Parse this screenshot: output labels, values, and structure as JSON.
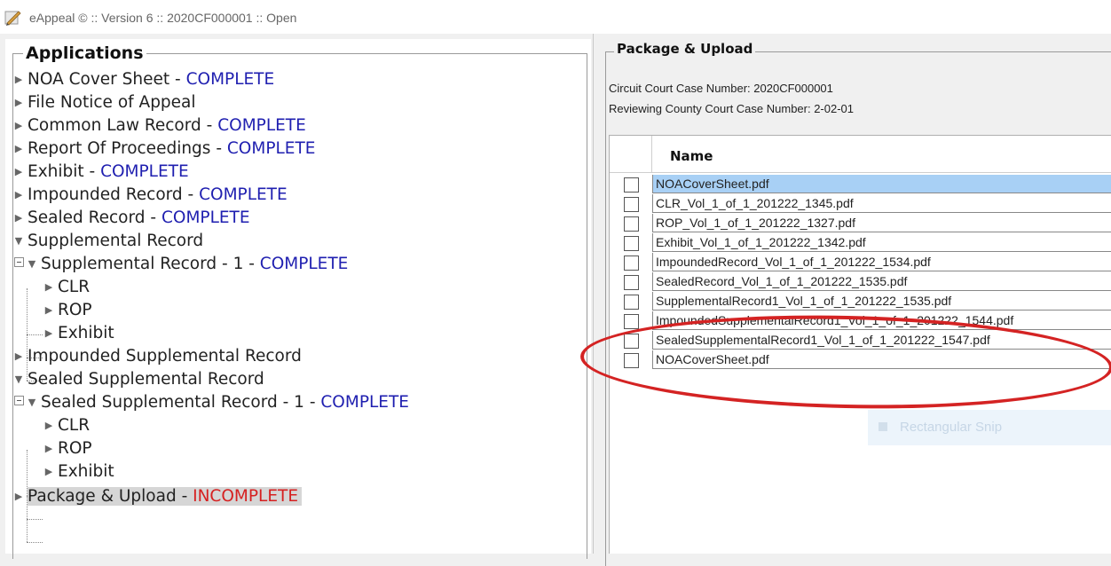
{
  "window": {
    "title": "eAppeal © :: Version 6 :: 2020CF000001 :: Open"
  },
  "colors": {
    "complete": "#1f1fb0",
    "incomplete": "#d62020",
    "selected_row": "#a8d0f5",
    "annotation": "#d42323"
  },
  "applications": {
    "title": "Applications",
    "items": [
      {
        "label": "NOA Cover Sheet - ",
        "status": "COMPLETE"
      },
      {
        "label": "File Notice of Appeal",
        "status": ""
      },
      {
        "label": "Common Law Record - ",
        "status": "COMPLETE"
      },
      {
        "label": "Report Of Proceedings - ",
        "status": "COMPLETE"
      },
      {
        "label": "Exhibit - ",
        "status": "COMPLETE"
      },
      {
        "label": "Impounded Record - ",
        "status": "COMPLETE"
      },
      {
        "label": "Sealed Record - ",
        "status": "COMPLETE"
      },
      {
        "label": "Supplemental Record",
        "status": ""
      },
      {
        "label": "Supplemental Record - 1 - ",
        "status": "COMPLETE"
      },
      {
        "label": "CLR",
        "status": ""
      },
      {
        "label": "ROP",
        "status": ""
      },
      {
        "label": "Exhibit",
        "status": ""
      },
      {
        "label": "Impounded Supplemental Record",
        "status": ""
      },
      {
        "label": "Sealed Supplemental Record",
        "status": ""
      },
      {
        "label": "Sealed Supplemental Record - 1 - ",
        "status": "COMPLETE"
      },
      {
        "label": "CLR",
        "status": ""
      },
      {
        "label": "ROP",
        "status": ""
      },
      {
        "label": "Exhibit",
        "status": ""
      },
      {
        "label": "Package & Upload - ",
        "status": "INCOMPLETE"
      }
    ]
  },
  "package": {
    "title": "Package & Upload",
    "circuit_case": "Circuit Court Case Number: 2020CF000001",
    "county_case": "Reviewing County Court Case Number: 2-02-01",
    "column_name": "Name",
    "files": [
      "NOACoverSheet.pdf",
      "CLR_Vol_1_of_1_201222_1345.pdf",
      "ROP_Vol_1_of_1_201222_1327.pdf",
      "Exhibit_Vol_1_of_1_201222_1342.pdf",
      "ImpoundedRecord_Vol_1_of_1_201222_1534.pdf",
      "SealedRecord_Vol_1_of_1_201222_1535.pdf",
      "SupplementalRecord1_Vol_1_of_1_201222_1535.pdf",
      "ImpoundedSupplementalRecord1_Vol_1_of_1_201222_1544.pdf",
      "SealedSupplementalRecord1_Vol_1_of_1_201222_1547.pdf",
      "NOACoverSheet.pdf"
    ],
    "snip_label": "Rectangular Snip"
  }
}
